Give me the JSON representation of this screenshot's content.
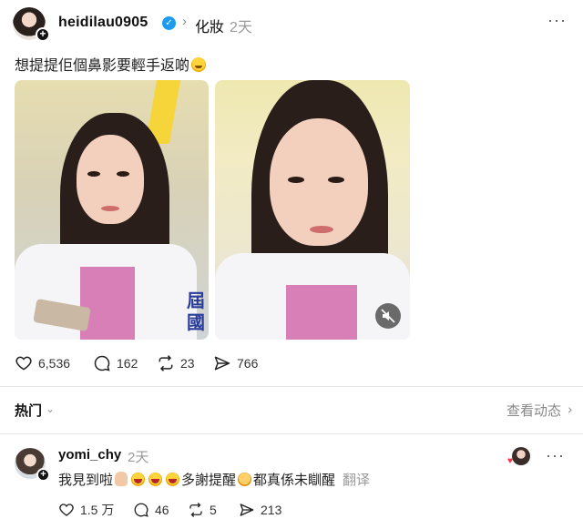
{
  "post": {
    "username": "heidilau0905",
    "verified_mark": "✓",
    "chevron": "›",
    "topic": "化妝",
    "time": "2天",
    "more": "···",
    "caption": "想提提佢個鼻影要輕手返啲",
    "media": {
      "left_sign_text": "屆\n國",
      "mute_icon": "speaker-muted-icon"
    },
    "stats": {
      "likes": "6,536",
      "comments": "162",
      "reposts": "23",
      "shares": "766"
    }
  },
  "sort": {
    "label": "热门",
    "chevron": "⌄",
    "view_activity": "查看动态",
    "view_chevron": "›"
  },
  "comment": {
    "username": "yomi_chy",
    "time": "2天",
    "more": "···",
    "text_part1": "我見到啦",
    "text_part2": "多謝提醒",
    "text_part3": "都真係未瞓醒",
    "translate": "翻译",
    "stats": {
      "likes": "1.5 万",
      "comments": "46",
      "reposts": "5",
      "shares": "213"
    }
  },
  "colors": {
    "verified_blue": "#1d9bf0",
    "like_red": "#ff3040",
    "muted_text": "#9a9a9a"
  }
}
